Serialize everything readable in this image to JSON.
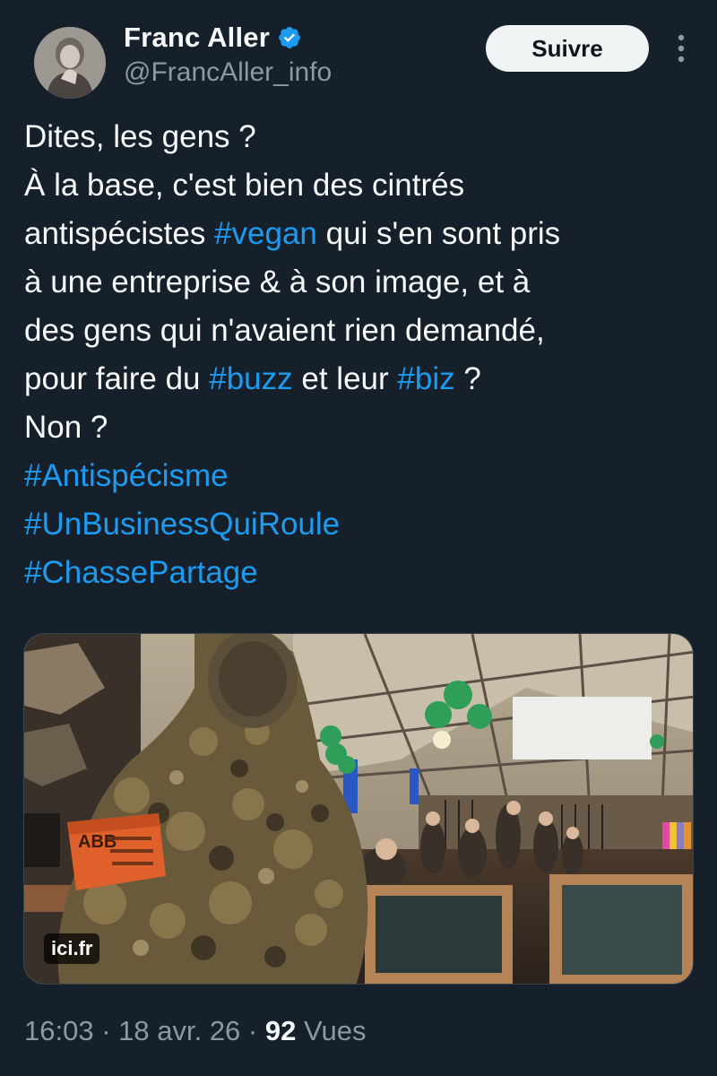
{
  "author": {
    "display_name": "Franc Aller",
    "handle": "@FrancAller_info",
    "verified_icon": "verified-badge-icon",
    "verified_color": "#1d9bf0"
  },
  "actions": {
    "follow_label": "Suivre",
    "more_icon": "more-vertical-icon"
  },
  "tweet": {
    "lines": [
      [
        {
          "text": "Dites, les gens ?"
        }
      ],
      [
        {
          "text": "À la base, c'est bien des cintrés"
        }
      ],
      [
        {
          "text": "antispécistes "
        },
        {
          "text": "#vegan",
          "tag": true
        },
        {
          "text": " qui s'en sont pris"
        }
      ],
      [
        {
          "text": "à une entreprise & à son image, et à"
        }
      ],
      [
        {
          "text": "des gens qui n'avaient rien demandé,"
        }
      ],
      [
        {
          "text": "pour faire du "
        },
        {
          "text": "#buzz",
          "tag": true
        },
        {
          "text": " et leur "
        },
        {
          "text": "#biz",
          "tag": true
        },
        {
          "text": " ?"
        }
      ],
      [
        {
          "text": "Non ?"
        }
      ],
      [
        {
          "text": "#Antispécisme",
          "tag": true
        }
      ],
      [
        {
          "text": "#UnBusinessQuiRoule",
          "tag": true
        }
      ],
      [
        {
          "text": "#ChassePartage",
          "tag": true
        }
      ]
    ],
    "hashtag_color": "#1d9bf0"
  },
  "media": {
    "source": "ici.fr",
    "armband_text": "ABB"
  },
  "meta": {
    "time": "16:03",
    "sep1": " · ",
    "date": "18 avr. 26",
    "sep2": " · ",
    "views": "92",
    "views_label": " Vues"
  },
  "colors": {
    "background": "#15202b",
    "text": "#f7f9f9",
    "secondary": "#8b98a5",
    "accent": "#1d9bf0"
  }
}
